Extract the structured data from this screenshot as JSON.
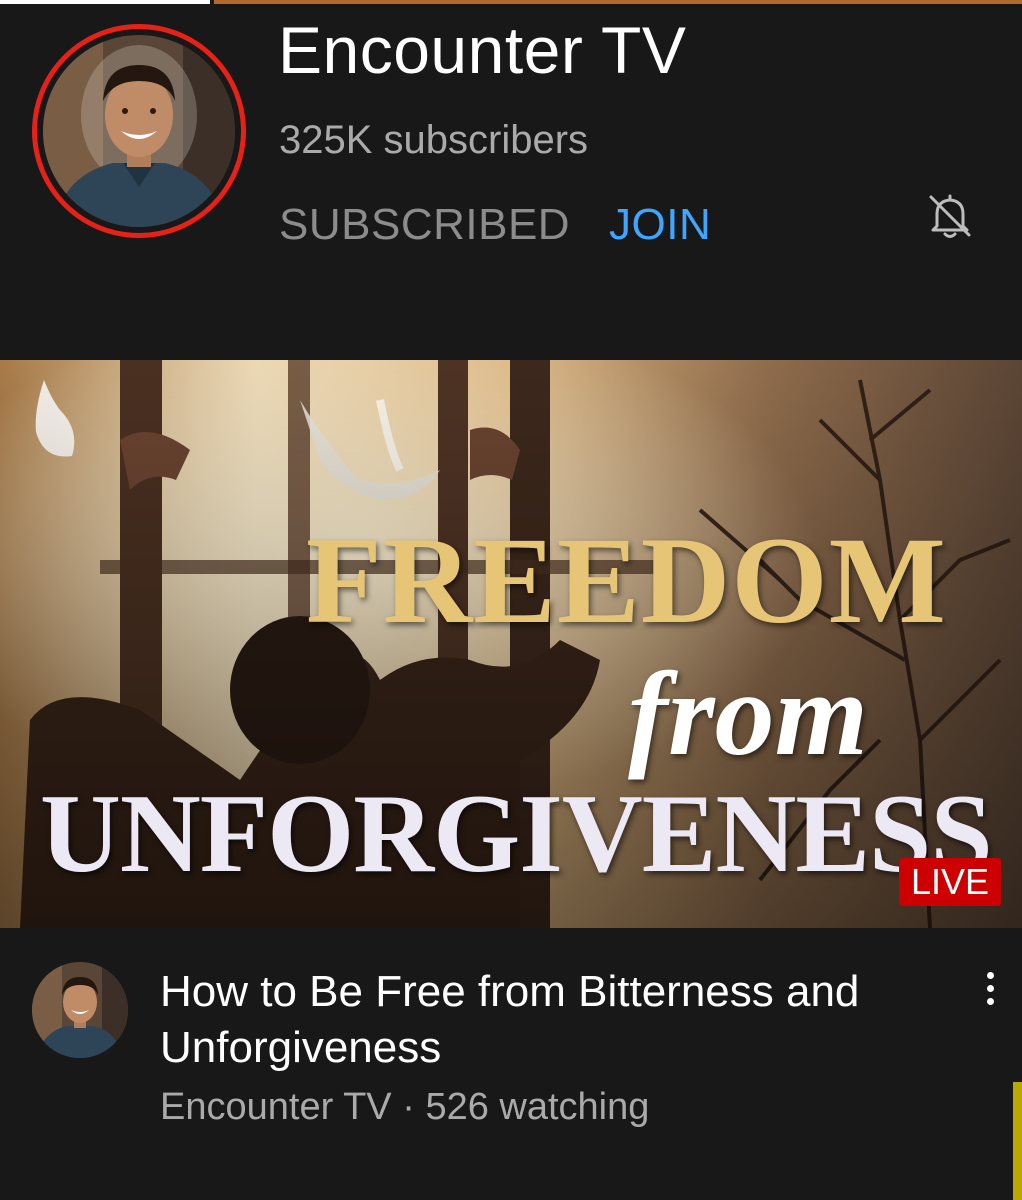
{
  "channel": {
    "name": "Encounter TV",
    "subscribers": "325K subscribers",
    "subscribed_label": "SUBSCRIBED",
    "join_label": "JOIN",
    "notification_icon": "bell-off-icon",
    "avatar_ring_color": "#e62117"
  },
  "thumbnail": {
    "line1": "FREEDOM",
    "line2": "from",
    "line3": "UNFORGIVENESS",
    "live_badge": "LIVE",
    "live_color": "#cc0000"
  },
  "video": {
    "title": "How to Be Free from Bitterness and Unforgiveness",
    "channel": "Encounter TV",
    "separator": "·",
    "watching": "526 watching",
    "menu_icon": "more-vert-icon"
  },
  "colors": {
    "background": "#181818",
    "accent_blue": "#3ea6ff",
    "muted_text": "#aaaaaa"
  }
}
